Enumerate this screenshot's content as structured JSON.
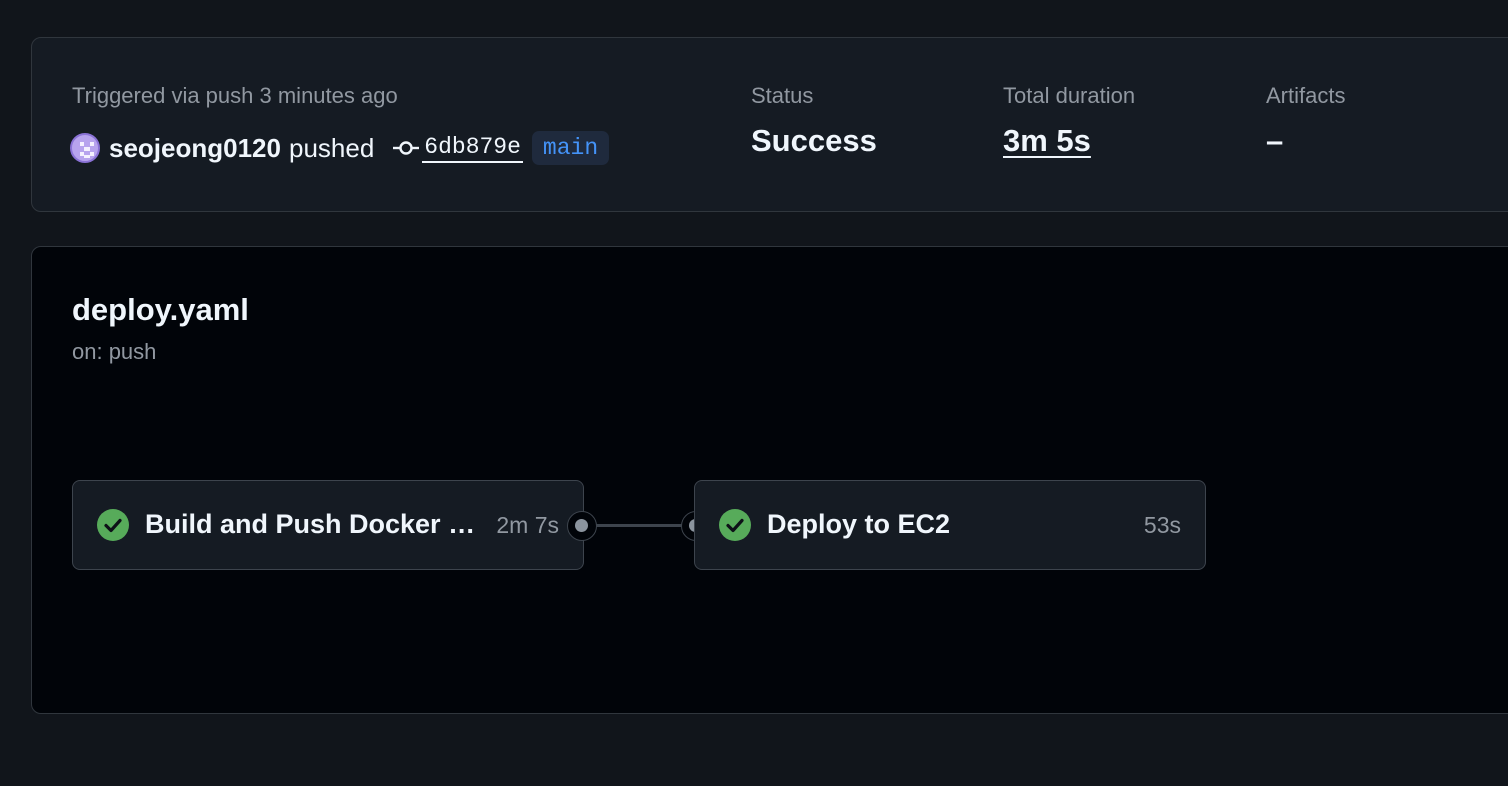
{
  "summary": {
    "trigger_text": "Triggered via push 3 minutes ago",
    "actor": "seojeong0120",
    "action": "pushed",
    "commit_sha": "6db879e",
    "branch": "main",
    "status_label": "Status",
    "status_value": "Success",
    "duration_label": "Total duration",
    "duration_value": "3m 5s",
    "artifacts_label": "Artifacts",
    "artifacts_value": "–"
  },
  "workflow": {
    "name": "deploy.yaml",
    "trigger": "on: push",
    "jobs": [
      {
        "name": "Build and Push Docker Image",
        "duration": "2m 7s",
        "status": "success"
      },
      {
        "name": "Deploy to EC2",
        "duration": "53s",
        "status": "success"
      }
    ]
  },
  "colors": {
    "success": "#57ab5a",
    "link": "#4493f8",
    "avatar": "#b7a3ee"
  },
  "icons": {
    "avatar": "identicon-avatar",
    "commit": "git-commit-icon",
    "success": "check-circle-fill-icon"
  }
}
